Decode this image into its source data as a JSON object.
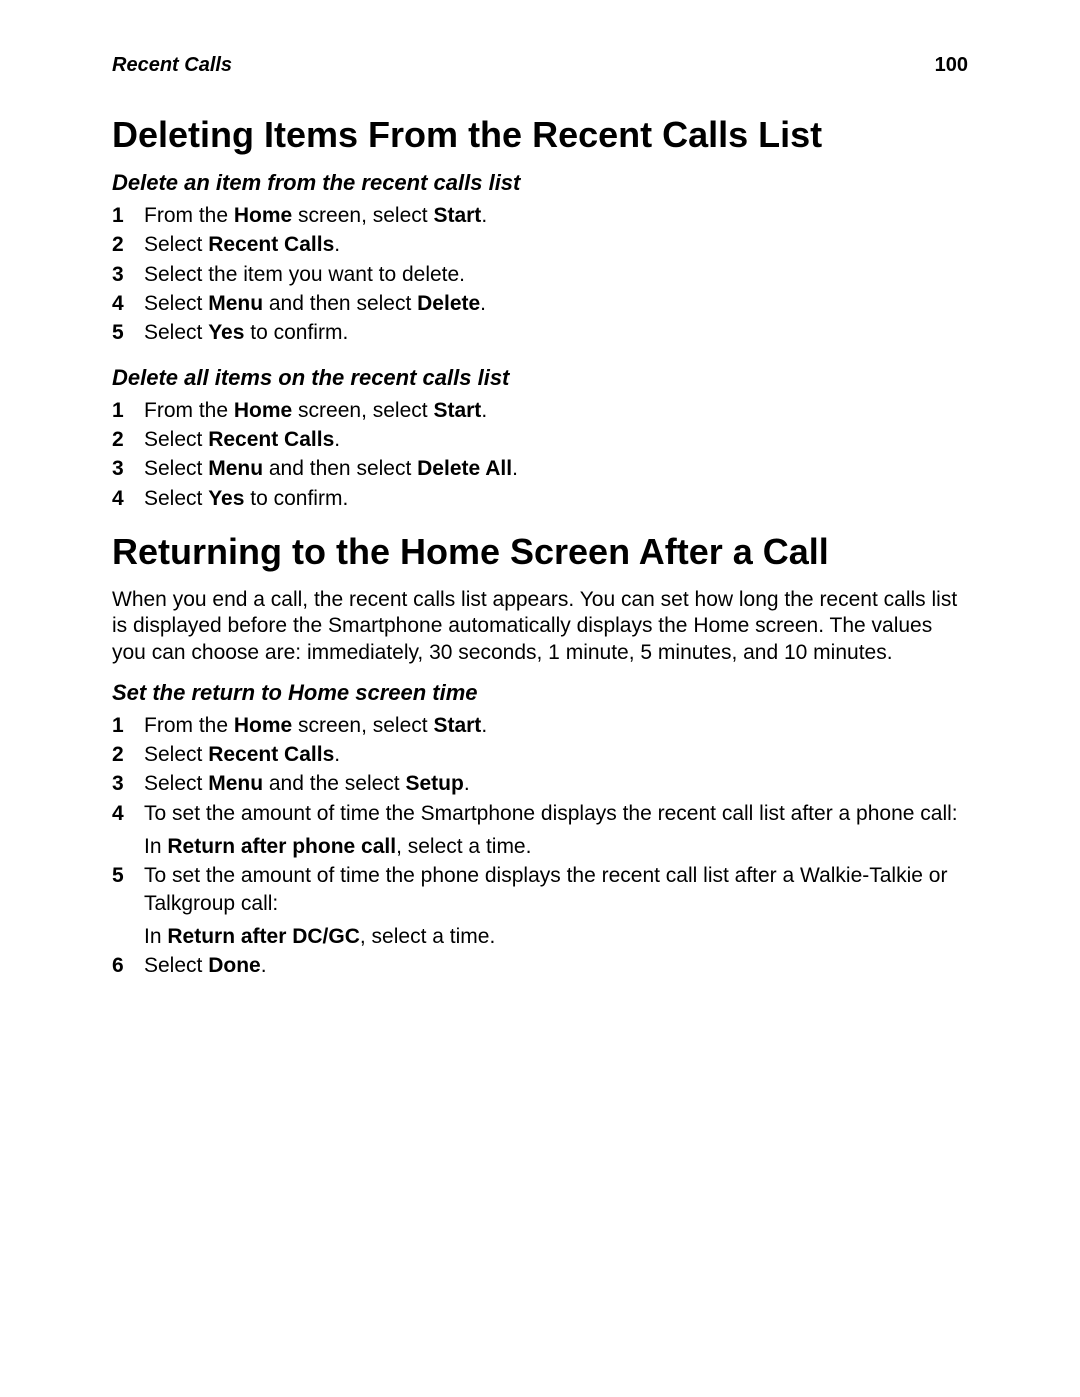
{
  "header": {
    "section": "Recent Calls",
    "page_number": "100"
  },
  "section1": {
    "title": "Deleting Items From the Recent Calls List",
    "sub1": {
      "title": "Delete an item from the recent calls list",
      "steps": [
        "From the <b>Home</b> screen, select <b>Start</b>.",
        "Select <b>Recent Calls</b>.",
        "Select the item you want to delete.",
        "Select <b>Menu</b> and then select <b>Delete</b>.",
        "Select <b>Yes</b> to confirm."
      ]
    },
    "sub2": {
      "title": "Delete all items on the recent calls list",
      "steps": [
        "From the <b>Home</b> screen, select <b>Start</b>.",
        "Select <b>Recent Calls</b>.",
        "Select <b>Menu</b> and then select <b>Delete All</b>.",
        "Select <b>Yes</b> to confirm."
      ]
    }
  },
  "section2": {
    "title": "Returning to the Home Screen After a Call",
    "intro": "When you end a call, the recent calls list appears. You can set how long the recent calls list is displayed before the Smartphone automatically displays the Home screen. The values you can choose are: immediately, 30 seconds, 1 minute, 5 minutes, and 10 minutes.",
    "sub1": {
      "title": "Set the return to Home screen time",
      "steps": [
        "From the <b>Home</b> screen, select <b>Start</b>.",
        "Select <b>Recent Calls</b>.",
        "Select <b>Menu</b> and the select <b>Setup</b>.",
        "To set the amount of time the Smartphone displays the recent call list after a phone call:<span class=\"step-extra\">In <b>Return after phone call</b>, select a time.</span>",
        "To set the amount of time the phone displays the recent call list after a Walkie-Talkie or Talkgroup call:<span class=\"step-extra\">In <b>Return after DC/GC</b>, select a time.</span>",
        "Select <b>Done</b>."
      ]
    }
  }
}
